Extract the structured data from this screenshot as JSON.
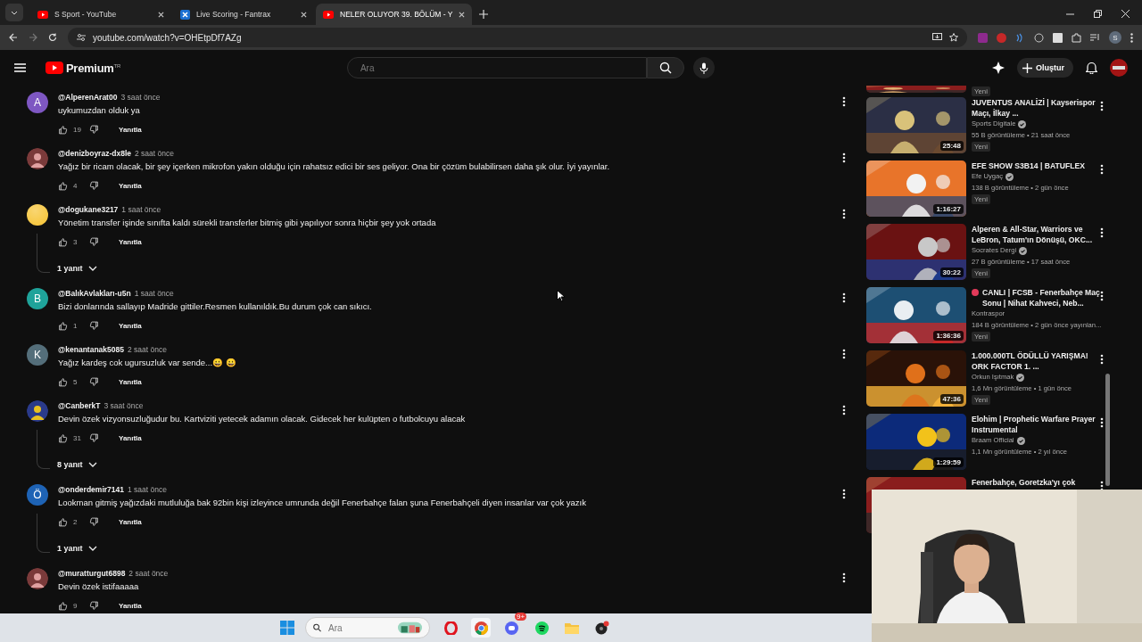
{
  "browser": {
    "tabs": [
      {
        "title": "S Sport - YouTube",
        "selected": false
      },
      {
        "title": "Live Scoring - Fantrax",
        "selected": false
      },
      {
        "title": "NELER OLUYOR 39. BÖLÜM - Y",
        "selected": true
      }
    ],
    "url": "youtube.com/watch?v=OHEtpDf7AZg",
    "profile": "S"
  },
  "header": {
    "logo": "Premium",
    "region": "TR",
    "search": {
      "placeholder": "Ara"
    },
    "create": "Oluştur"
  },
  "comments": [
    {
      "author": "@AlperenArat00",
      "time": "3 saat önce",
      "text": "uykumuzdan olduk ya",
      "likes": "19",
      "reply": "Yanıtla",
      "avatar": {
        "kind": "letter",
        "letter": "A",
        "color": "#7e57c2"
      }
    },
    {
      "author": "@denizboyraz-dx8le",
      "time": "2 saat önce",
      "text": "Yağız bir ricam olacak, bir şey içerken mikrofon yakın olduğu için rahatsız edici bir ses geliyor. Ona bir çözüm bulabilirsen daha şık olur. İyi yayınlar.",
      "likes": "4",
      "reply": "Yanıtla"
    },
    {
      "author": "@dogukane3217",
      "time": "1 saat önce",
      "text": "Yönetim transfer işinde sınıfta kaldı sürekli transferler bitmiş gibi yapılıyor sonra hiçbir şey yok ortada",
      "likes": "3",
      "reply": "Yanıtla",
      "avatar": {
        "kind": "plain",
        "color": "#f7c843"
      },
      "replies": "1 yanıt"
    },
    {
      "author": "@BalıkAvlakları-u5n",
      "time": "1 saat önce",
      "text": "Bizi donlarında sallayıp Madride gittiler.Resmen kullanıldık.Bu durum çok can sıkıcı.",
      "likes": "1",
      "reply": "Yanıtla",
      "avatar": {
        "kind": "letter",
        "letter": "B",
        "color": "#1fa39a"
      }
    },
    {
      "author": "@kenantanak5085",
      "time": "2 saat önce",
      "text": "Yağız kardeş cok ugursuzluk var sende...😀 😀",
      "likes": "5",
      "reply": "Yanıtla",
      "avatar": {
        "kind": "letter",
        "letter": "K",
        "color": "#546e7a"
      }
    },
    {
      "author": "@CanberkT",
      "time": "3 saat önce",
      "text": "Devin özek vizyonsuzluğudur bu. Kartviziti yetecek adamın olacak. Gidecek her kulüpten o futbolcuyu alacak",
      "likes": "31",
      "reply": "Yanıtla",
      "replies": "8 yanıt"
    },
    {
      "author": "@onderdemir7141",
      "time": "1 saat önce",
      "text": "Lookman gitmiş yağızdaki mutluluğa bak 92bin kişi izleyince umrunda değil Fenerbahçe falan şuna Fenerbahçeli diyen insanlar var çok yazık",
      "likes": "2",
      "reply": "Yanıtla",
      "avatar": {
        "kind": "letter",
        "letter": "Ö",
        "color": "#1e63b5"
      },
      "replies": "1 yanıt"
    },
    {
      "author": "@muratturgut6898",
      "time": "2 saat önce",
      "text": "Devin özek istifaaaaa",
      "likes": "9",
      "reply": "Yanıtla"
    }
  ],
  "videos": [
    {
      "kind": "partial",
      "badge": "Yeni"
    },
    {
      "kind": "full",
      "title": "JUVENTUS ANALİZİ | Kayserispor Maçı, İlkay ...",
      "channel": "Sports Digitale",
      "verified": true,
      "meta": "55 B görüntüleme • 21 saat önce",
      "duration": "25:48",
      "badge": "Yeni",
      "live": false
    },
    {
      "kind": "full",
      "title": "EFE SHOW S3B14 | BATUFLEX",
      "channel": "Efe Uygaç",
      "verified": true,
      "meta": "138 B görüntüleme • 2 gün önce",
      "duration": "1:16:27",
      "badge": "Yeni",
      "live": false
    },
    {
      "kind": "full",
      "title": "Alperen & All-Star, Warriors ve LeBron, Tatum'ın Dönüşü, OKC...",
      "channel": "Socrates Dergi",
      "verified": true,
      "meta": "27 B görüntüleme • 17 saat önce",
      "duration": "30:22",
      "badge": "Yeni",
      "live": false
    },
    {
      "kind": "full",
      "title": "CANLI | FCSB - Fenerbahçe Maç Sonu | Nihat Kahveci, Neb...",
      "channel": "Kontraspor",
      "verified": false,
      "meta": "184 B görüntüleme • 2 gün önce yayınlan...",
      "duration": "1:36:36",
      "badge": "Yeni",
      "live": true
    },
    {
      "kind": "full",
      "title": "1.000.000TL ÖDÜLLÜ YARIŞMA! ORK FACTOR 1. ...",
      "channel": "Orkun Işıtmak",
      "verified": true,
      "meta": "1,6 Mn görüntüleme • 1 gün önce",
      "duration": "47:36",
      "badge": "Yeni",
      "live": false
    },
    {
      "kind": "full",
      "title": "Elohim | Prophetic Warfare Prayer Instrumental",
      "channel": "Braam Official",
      "verified": true,
      "meta": "1,1 Mn görüntüleme • 2 yıl önce",
      "duration": "1:29:59",
      "live": false
    },
    {
      "kind": "cut",
      "title": "Fenerbahçe, Goretzka'yı çok"
    }
  ],
  "taskbar": {
    "search": {
      "placeholder": "Ara"
    },
    "discord_badge": "9+"
  }
}
